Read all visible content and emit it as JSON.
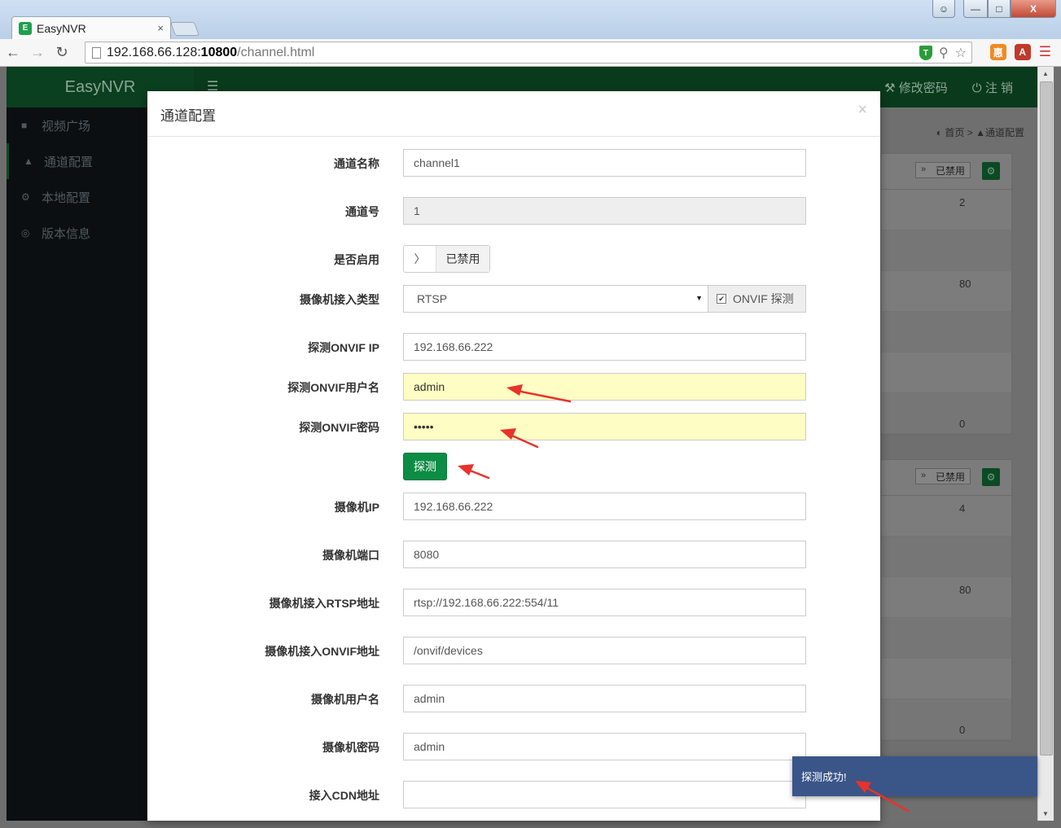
{
  "browser": {
    "tab_title": "EasyNVR",
    "tab_close": "×",
    "url_prefix": "192.168.66.128:",
    "url_port": "10800",
    "url_path": "/channel.html",
    "min_glyph": "—",
    "max_glyph": "□",
    "close_glyph": "X"
  },
  "app": {
    "logo": "EasyNVR",
    "header_links": {
      "change_password": "修改密码",
      "logout": "注 销"
    },
    "sidebar": [
      {
        "label": "视频广场",
        "icon": "video-icon"
      },
      {
        "label": "通道配置",
        "icon": "road-icon"
      },
      {
        "label": "本地配置",
        "icon": "cogs-icon"
      },
      {
        "label": "版本信息",
        "icon": "globe-icon"
      }
    ],
    "breadcrumb": {
      "home": "首页",
      "sep": ">",
      "current": "通道配置"
    },
    "panels": [
      {
        "switch": "已禁用",
        "values": [
          "2",
          "80",
          "0"
        ]
      },
      {
        "switch": "已禁用",
        "values": [
          "4",
          "80",
          "0"
        ]
      }
    ]
  },
  "modal": {
    "title": "通道配置",
    "close": "×",
    "fields": {
      "channel_name": {
        "label": "通道名称",
        "value": "channel1"
      },
      "channel_no": {
        "label": "通道号",
        "value": "1"
      },
      "enabled": {
        "label": "是否启用",
        "toggle_text": "已禁用"
      },
      "access_type": {
        "label": "摄像机接入类型",
        "value": "RTSP",
        "onvif_probe": "ONVIF 探测"
      },
      "probe_ip": {
        "label": "探测ONVIF IP",
        "value": "192.168.66.222"
      },
      "probe_user": {
        "label": "探测ONVIF用户名",
        "value": "admin"
      },
      "probe_pass": {
        "label": "探测ONVIF密码",
        "value": "•••••"
      },
      "probe_button": "探测",
      "camera_ip": {
        "label": "摄像机IP",
        "value": "192.168.66.222"
      },
      "camera_port": {
        "label": "摄像机端口",
        "value": "8080"
      },
      "rtsp_url": {
        "label": "摄像机接入RTSP地址",
        "value": "rtsp://192.168.66.222:554/11"
      },
      "onvif_url": {
        "label": "摄像机接入ONVIF地址",
        "value": "/onvif/devices"
      },
      "camera_user": {
        "label": "摄像机用户名",
        "value": "admin"
      },
      "camera_pass": {
        "label": "摄像机密码",
        "value": "admin"
      },
      "cdn_url": {
        "label": "接入CDN地址",
        "value": ""
      }
    }
  },
  "toast": {
    "message": "探测成功!"
  },
  "colors": {
    "brand_green": "#0c8c45",
    "highlight_yellow": "#fdfdc4",
    "toast_blue": "#3a5588",
    "annotation_red": "#e8322b"
  }
}
